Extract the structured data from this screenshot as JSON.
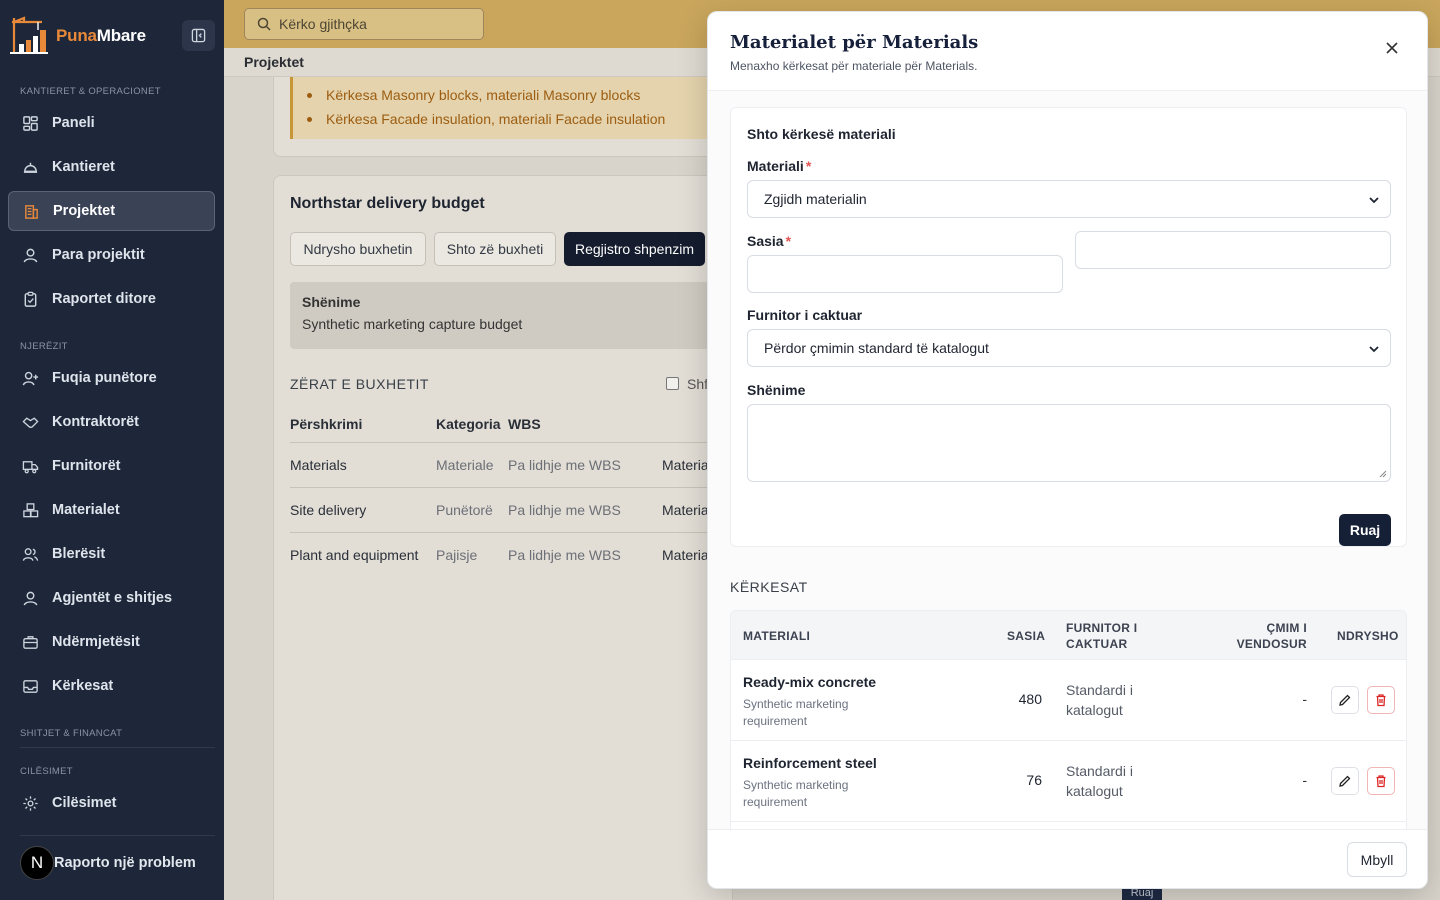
{
  "app": {
    "brand_part1": "Puna",
    "brand_part2": "Mbare"
  },
  "sidebar": {
    "section_sites": "KANTIERET & OPERACIONET",
    "section_people": "NJERËZIT",
    "section_finance": "SHITJET & FINANCAT",
    "section_settings": "CILËSIMET",
    "items": [
      {
        "label": "Paneli",
        "icon": "dashboard-icon"
      },
      {
        "label": "Kantieret",
        "icon": "helmet-icon"
      },
      {
        "label": "Projektet",
        "icon": "building-icon",
        "active": true
      },
      {
        "label": "Para projektit",
        "icon": "user-icon"
      },
      {
        "label": "Raportet ditore",
        "icon": "clipboard-icon"
      },
      {
        "label": "Fuqia punëtore",
        "icon": "user-plus-icon"
      },
      {
        "label": "Kontraktorët",
        "icon": "handshake-icon"
      },
      {
        "label": "Furnitorët",
        "icon": "truck-icon"
      },
      {
        "label": "Materialet",
        "icon": "boxes-icon"
      },
      {
        "label": "Blerësit",
        "icon": "users-icon"
      },
      {
        "label": "Agjentët e shitjes",
        "icon": "user-icon"
      },
      {
        "label": "Ndërmjetësit",
        "icon": "briefcase-icon"
      },
      {
        "label": "Kërkesat",
        "icon": "inbox-icon"
      },
      {
        "label": "Cilësimet",
        "icon": "gear-icon"
      }
    ],
    "avatar_letter": "N",
    "report_label": "Raporto një problem"
  },
  "topbar": {
    "search_placeholder": "Kërko gjithçka",
    "breadcrumb": "Projektet"
  },
  "background": {
    "warnings": [
      "Kërkesa Masonry blocks, materiali Masonry blocks",
      "Kërkesa Facade insulation, materiali Facade insulation"
    ],
    "budget_title": "Northstar delivery budget",
    "btn_edit": "Ndrysho buxhetin",
    "btn_add": "Shto zë buxheti",
    "btn_record": "Regjistro shpenzim",
    "note_label": "Shënime",
    "note_text": "Synthetic marketing capture budget",
    "items_title": "ZËRAT E BUXHETIT",
    "show_label": "Shf",
    "columns": [
      "Përshkrimi",
      "Kategoria",
      "WBS"
    ],
    "rows": [
      {
        "desc": "Materials",
        "cat": "Materiale",
        "wbs": "Pa lidhje me WBS",
        "extra": "Materia"
      },
      {
        "desc": "Site delivery",
        "cat": "Punëtorë",
        "wbs": "Pa lidhje me WBS",
        "extra": "Materia"
      },
      {
        "desc": "Plant and equipment",
        "cat": "Pajisje",
        "wbs": "Pa lidhje me WBS",
        "extra": "Materia"
      }
    ],
    "ruaj_peek": "Ruaj"
  },
  "modal": {
    "title": "Materialet për Materials",
    "subtitle": "Menaxho kërkesat për materiale për Materials.",
    "form_title": "Shto kërkesë materiali",
    "material_label": "Materiali",
    "material_select": "Zgjidh materialin",
    "qty_label": "Sasia",
    "supplier_label": "Furnitor i caktuar",
    "supplier_select": "Përdor çmimin standard të katalogut",
    "notes_label": "Shënime",
    "save_label": "Ruaj",
    "requests_title": "KËRKESAT",
    "table_headers": {
      "material": "MATERIALI",
      "qty": "SASIA",
      "supplier_l1": "FURNITOR I",
      "supplier_l2": "CAKTUAR",
      "price_l1": "ÇMIM I",
      "price_l2": "VENDOSUR",
      "edit": "NDRYSHO"
    },
    "requests": [
      {
        "name": "Ready-mix concrete",
        "note_l1": "Synthetic marketing",
        "note_l2": "requirement",
        "qty": "480",
        "sup_l1": "Standardi i",
        "sup_l2": "katalogut",
        "price": "-"
      },
      {
        "name": "Reinforcement steel",
        "note_l1": "Synthetic marketing",
        "note_l2": "requirement",
        "qty": "76",
        "sup_l1": "Standardi i",
        "sup_l2": "katalogut",
        "price": "-"
      }
    ],
    "close_label": "Mbyll"
  },
  "colors": {
    "sidebar": "#1d2739",
    "accent": "#c9a65c",
    "primary": "#151f36",
    "danger": "#e05454"
  }
}
